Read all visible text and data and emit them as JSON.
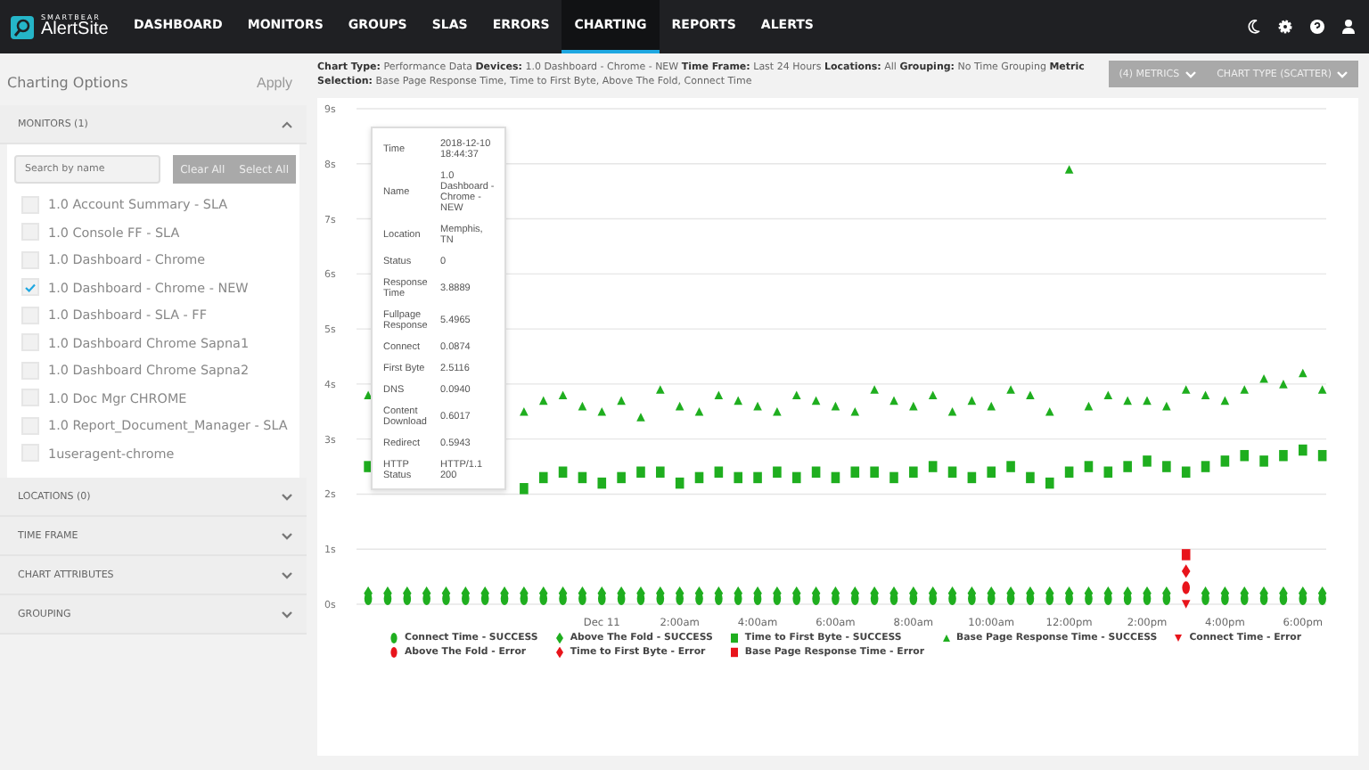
{
  "brand": {
    "company": "SMARTBEAR",
    "product": "AlertSite"
  },
  "nav": [
    {
      "label": "DASHBOARD",
      "selected": false
    },
    {
      "label": "MONITORS",
      "selected": false
    },
    {
      "label": "GROUPS",
      "selected": false
    },
    {
      "label": "SLAS",
      "selected": false
    },
    {
      "label": "ERRORS",
      "selected": false
    },
    {
      "label": "CHARTING",
      "selected": true
    },
    {
      "label": "REPORTS",
      "selected": false
    },
    {
      "label": "ALERTS",
      "selected": false
    }
  ],
  "sidebar": {
    "title": "Charting Options",
    "apply": "Apply",
    "sections": [
      {
        "label": "MONITORS (1)",
        "expanded": true,
        "search_placeholder": "Search by name",
        "clear": "Clear All",
        "select": "Select All",
        "items": [
          {
            "label": "1.0 Account Summary - SLA",
            "checked": false
          },
          {
            "label": "1.0 Console FF - SLA",
            "checked": false
          },
          {
            "label": "1.0 Dashboard - Chrome",
            "checked": false
          },
          {
            "label": "1.0 Dashboard - Chrome - NEW",
            "checked": true
          },
          {
            "label": "1.0 Dashboard - SLA - FF",
            "checked": false
          },
          {
            "label": "1.0 Dashboard Chrome Sapna1",
            "checked": false
          },
          {
            "label": "1.0 Dashboard Chrome Sapna2",
            "checked": false
          },
          {
            "label": "1.0 Doc Mgr CHROME",
            "checked": false
          },
          {
            "label": "1.0 Report_Document_Manager - SLA",
            "checked": false
          },
          {
            "label": "1useragent-chrome",
            "checked": false
          }
        ]
      },
      {
        "label": "LOCATIONS (0)",
        "expanded": false
      },
      {
        "label": "TIME FRAME",
        "expanded": false
      },
      {
        "label": "CHART ATTRIBUTES",
        "expanded": false
      },
      {
        "label": "GROUPING",
        "expanded": false
      }
    ]
  },
  "summary": "**Chart Type:** Performance Data **Devices:** 1.0 Dashboard - Chrome - NEW **Time Frame:** Last 24 Hours **Locations:** All **Grouping:** No Time Grouping **Metric Selection:** Base Page Response Time, Time to First Byte, Above The Fold, Connect Time",
  "metrics_button": "(4) METRICS",
  "chart_type_button": "CHART TYPE (SCATTER)",
  "chart_data": {
    "type": "scatter",
    "grid": true,
    "xlim": [
      -6.3,
      18.6
    ],
    "ylim": [
      0,
      9
    ],
    "yticks": [
      {
        "value": 0,
        "label": "0s"
      },
      {
        "value": 1,
        "label": "1s"
      },
      {
        "value": 2,
        "label": "2s"
      },
      {
        "value": 3,
        "label": "3s"
      },
      {
        "value": 4,
        "label": "4s"
      },
      {
        "value": 5,
        "label": "5s"
      },
      {
        "value": 6,
        "label": "6s"
      },
      {
        "value": 7,
        "label": "7s"
      },
      {
        "value": 8,
        "label": "8s"
      },
      {
        "value": 9,
        "label": "9s"
      }
    ],
    "xticks": [
      {
        "value": 0,
        "label": "Dec 11"
      },
      {
        "value": 2,
        "label": "2:00am"
      },
      {
        "value": 4,
        "label": "4:00am"
      },
      {
        "value": 6,
        "label": "6:00am"
      },
      {
        "value": 8,
        "label": "8:00am"
      },
      {
        "value": 10,
        "label": "10:00am"
      },
      {
        "value": 12,
        "label": "12:00pm"
      },
      {
        "value": 14,
        "label": "2:00pm"
      },
      {
        "value": 16,
        "label": "4:00pm"
      },
      {
        "value": 18,
        "label": "6:00pm"
      }
    ],
    "x": [
      -6,
      -5.5,
      -5,
      -4.5,
      -4,
      -3.5,
      -3,
      -2.5,
      -2,
      -1.5,
      -1,
      -0.5,
      0,
      0.5,
      1,
      1.5,
      2,
      2.5,
      3,
      3.5,
      4,
      4.5,
      5,
      5.5,
      6,
      6.5,
      7,
      7.5,
      8,
      8.5,
      9,
      9.5,
      10,
      10.5,
      11,
      11.5,
      12,
      12.5,
      13,
      13.5,
      14,
      14.5,
      15,
      15.5,
      16,
      16.5,
      17,
      17.5,
      18,
      18.5
    ],
    "series": [
      {
        "name": "Connect Time - SUCCESS",
        "color": "#1fae1f",
        "marker": "circle",
        "values": [
          0.1,
          0.1,
          0.1,
          0.1,
          0.1,
          0.1,
          0.1,
          0.1,
          0.1,
          0.1,
          0.1,
          0.1,
          0.1,
          0.1,
          0.1,
          0.1,
          0.1,
          0.1,
          0.1,
          0.1,
          0.1,
          0.1,
          0.1,
          0.1,
          0.1,
          0.1,
          0.1,
          0.1,
          0.1,
          0.1,
          0.1,
          0.1,
          0.1,
          0.1,
          0.1,
          0.1,
          0.1,
          0.1,
          0.1,
          0.1,
          0.1,
          0.1,
          null,
          0.1,
          0.1,
          0.1,
          0.1,
          0.1,
          0.1,
          0.1
        ]
      },
      {
        "name": "Above The Fold - SUCCESS",
        "color": "#1fae1f",
        "marker": "diamond",
        "values": [
          0.2,
          0.2,
          0.2,
          0.2,
          0.2,
          0.2,
          0.2,
          0.2,
          0.2,
          0.2,
          0.2,
          0.2,
          0.2,
          0.2,
          0.2,
          0.2,
          0.2,
          0.2,
          0.2,
          0.2,
          0.2,
          0.2,
          0.2,
          0.2,
          0.2,
          0.2,
          0.2,
          0.2,
          0.2,
          0.2,
          0.2,
          0.2,
          0.2,
          0.2,
          0.2,
          0.2,
          0.2,
          0.2,
          0.2,
          0.2,
          0.2,
          0.2,
          null,
          0.2,
          0.2,
          0.2,
          0.2,
          0.2,
          0.2,
          0.2
        ]
      },
      {
        "name": "Time to First Byte - SUCCESS",
        "color": "#1fae1f",
        "marker": "square",
        "values": [
          2.5,
          null,
          null,
          null,
          null,
          null,
          null,
          null,
          2.1,
          2.3,
          2.4,
          2.3,
          2.2,
          2.3,
          2.4,
          2.4,
          2.2,
          2.3,
          2.4,
          2.3,
          2.3,
          2.4,
          2.3,
          2.4,
          2.3,
          2.4,
          2.4,
          2.3,
          2.4,
          2.5,
          2.4,
          2.3,
          2.4,
          2.5,
          2.3,
          2.2,
          2.4,
          2.5,
          2.4,
          2.5,
          2.6,
          2.5,
          2.4,
          2.5,
          2.6,
          2.7,
          2.6,
          2.7,
          2.8,
          2.7
        ]
      },
      {
        "name": "Base Page Response Time - SUCCESS",
        "color": "#1fae1f",
        "marker": "triangle",
        "values": [
          3.8,
          null,
          null,
          null,
          null,
          null,
          null,
          null,
          3.5,
          3.7,
          3.8,
          3.6,
          3.5,
          3.7,
          3.4,
          3.9,
          3.6,
          3.5,
          3.8,
          3.7,
          3.6,
          3.5,
          3.8,
          3.7,
          3.6,
          3.5,
          3.9,
          3.7,
          3.6,
          3.8,
          3.5,
          3.7,
          3.6,
          3.9,
          3.8,
          3.5,
          7.9,
          3.6,
          3.8,
          3.7,
          3.7,
          3.6,
          3.9,
          3.8,
          3.7,
          3.9,
          4.1,
          4.0,
          4.2,
          3.9
        ]
      },
      {
        "name": "Connect Time - Error",
        "color": "#e8141b",
        "marker": "triangle-down",
        "values": [
          null,
          null,
          null,
          null,
          null,
          null,
          null,
          null,
          null,
          null,
          null,
          null,
          null,
          null,
          null,
          null,
          null,
          null,
          null,
          null,
          null,
          null,
          null,
          null,
          null,
          null,
          null,
          null,
          null,
          null,
          null,
          null,
          null,
          null,
          null,
          null,
          null,
          null,
          null,
          null,
          null,
          null,
          0,
          null,
          null,
          null,
          null,
          null,
          null,
          null
        ]
      },
      {
        "name": "Above The Fold - Error",
        "color": "#e8141b",
        "marker": "circle",
        "values": [
          null,
          null,
          null,
          null,
          null,
          null,
          null,
          null,
          null,
          null,
          null,
          null,
          null,
          null,
          null,
          null,
          null,
          null,
          null,
          null,
          null,
          null,
          null,
          null,
          null,
          null,
          null,
          null,
          null,
          null,
          null,
          null,
          null,
          null,
          null,
          null,
          null,
          null,
          null,
          null,
          null,
          null,
          0.3,
          null,
          null,
          null,
          null,
          null,
          null,
          null
        ]
      },
      {
        "name": "Time to First Byte - Error",
        "color": "#e8141b",
        "marker": "diamond",
        "values": [
          null,
          null,
          null,
          null,
          null,
          null,
          null,
          null,
          null,
          null,
          null,
          null,
          null,
          null,
          null,
          null,
          null,
          null,
          null,
          null,
          null,
          null,
          null,
          null,
          null,
          null,
          null,
          null,
          null,
          null,
          null,
          null,
          null,
          null,
          null,
          null,
          null,
          null,
          null,
          null,
          null,
          null,
          0.6,
          null,
          null,
          null,
          null,
          null,
          null,
          null
        ]
      },
      {
        "name": "Base Page Response Time - Error",
        "color": "#e8141b",
        "marker": "square",
        "values": [
          null,
          null,
          null,
          null,
          null,
          null,
          null,
          null,
          null,
          null,
          null,
          null,
          null,
          null,
          null,
          null,
          null,
          null,
          null,
          null,
          null,
          null,
          null,
          null,
          null,
          null,
          null,
          null,
          null,
          null,
          null,
          null,
          null,
          null,
          null,
          null,
          null,
          null,
          null,
          null,
          null,
          null,
          0.9,
          null,
          null,
          null,
          null,
          null,
          null,
          null
        ]
      }
    ]
  },
  "tooltip": [
    {
      "label": "Time",
      "value": "2018-12-10 18:44:37"
    },
    {
      "label": "Name",
      "value": "1.0 Dashboard - Chrome - NEW"
    },
    {
      "label": "Location",
      "value": "Memphis, TN"
    },
    {
      "label": "Status",
      "value": "0"
    },
    {
      "label": "Response Time",
      "value": "3.8889"
    },
    {
      "label": "Fullpage Response",
      "value": "5.4965"
    },
    {
      "label": "Connect",
      "value": "0.0874"
    },
    {
      "label": "First Byte",
      "value": "2.5116"
    },
    {
      "label": "DNS",
      "value": "0.0940"
    },
    {
      "label": "Content Download",
      "value": "0.6017"
    },
    {
      "label": "Redirect",
      "value": "0.5943"
    },
    {
      "label": "HTTP Status",
      "value": "HTTP/1.1 200"
    }
  ]
}
